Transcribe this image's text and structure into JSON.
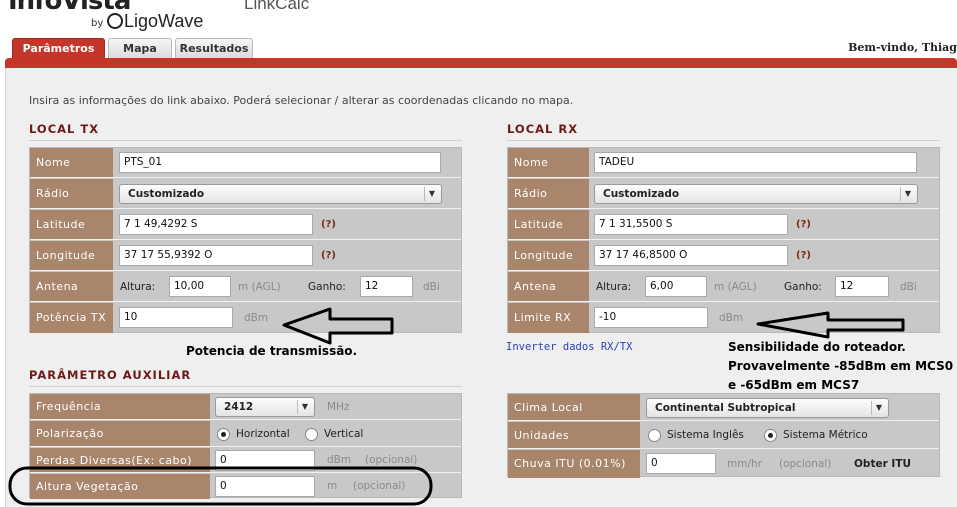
{
  "branding": {
    "logo_text": "InfoVista",
    "by": "by",
    "sub": "LigoWave",
    "app_title": "LinkCalc"
  },
  "tabs": [
    {
      "label": "Parâmetros",
      "active": true
    },
    {
      "label": "Mapa",
      "active": false
    },
    {
      "label": "Resultados",
      "active": false
    }
  ],
  "welcome": "Bem-vindo, Thiag",
  "intro": "Insira as informações do link abaixo. Poderá selecionar / alterar as coordenadas clicando no mapa.",
  "local_tx": {
    "title": "LOCAL TX",
    "nome_label": "Nome",
    "nome_value": "PTS_01",
    "radio_label": "Rádio",
    "radio_value": "Customizado",
    "lat_label": "Latitude",
    "lat_value": "7 1 49,4292 S",
    "lon_label": "Longitude",
    "lon_value": "37 17 55,9392 O",
    "help": "(?)",
    "antena_label": "Antena",
    "altura_label": "Altura:",
    "altura_value": "10,00",
    "altura_unit": "m  (AGL)",
    "ganho_label": "Ganho:",
    "ganho_value": "12",
    "ganho_unit": "dBi",
    "potencia_label": "Potência TX",
    "potencia_value": "10",
    "potencia_unit": "dBm"
  },
  "local_rx": {
    "title": "LOCAL RX",
    "nome_label": "Nome",
    "nome_value": "TADEU",
    "radio_label": "Rádio",
    "radio_value": "Customizado",
    "lat_label": "Latitude",
    "lat_value": "7 1 31,5500 S",
    "lon_label": "Longitude",
    "lon_value": "37 17 46,8500 O",
    "help": "(?)",
    "antena_label": "Antena",
    "altura_label": "Altura:",
    "altura_value": "6,00",
    "altura_unit": "m  (AGL)",
    "ganho_label": "Ganho:",
    "ganho_value": "12",
    "ganho_unit": "dBi",
    "limite_label": "Limite RX",
    "limite_value": "-10",
    "limite_unit": "dBm",
    "invert_link": "Inverter dados RX/TX"
  },
  "auxiliar": {
    "title": "PARÂMETRO AUXILIAR",
    "freq_label": "Frequência",
    "freq_value": "2412",
    "freq_unit": "MHz",
    "pol_label": "Polarização",
    "pol_h": "Horizontal",
    "pol_v": "Vertical",
    "pol_selected": "Horizontal",
    "perdas_label": "Perdas Diversas(Ex: cabo)",
    "perdas_value": "0",
    "perdas_unit": "dBm",
    "perdas_opt": "(opcional)",
    "veg_label": "Altura Vegetação",
    "veg_value": "0",
    "veg_unit": "m",
    "veg_opt": "(opcional)"
  },
  "clima": {
    "clima_label": "Clima Local",
    "clima_value": "Continental Subtropical",
    "unid_label": "Unidades",
    "unid_ingles": "Sistema Inglês",
    "unid_metrico": "Sistema Métrico",
    "unid_selected": "Sistema Métrico",
    "chuva_label": "Chuva ITU (0.01%)",
    "chuva_value": "0",
    "chuva_unit": "mm/hr",
    "chuva_opt": "(opcional)",
    "obter": "Obter ITU"
  },
  "annotations": {
    "tx_note": "Potencia de transmissão.",
    "rx_note_1": "Sensibilidade do roteador.",
    "rx_note_2": "Provavelmente -85dBm em MCS0",
    "rx_note_3": "e -65dBm em MCS7"
  }
}
